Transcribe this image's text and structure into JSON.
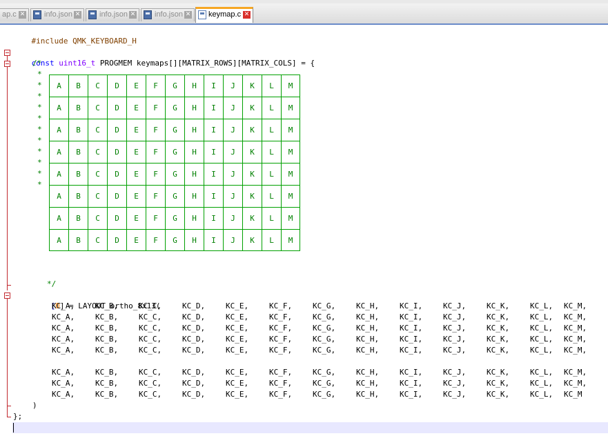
{
  "tabs": [
    {
      "label": "ap.c",
      "active": false
    },
    {
      "label": "info.json",
      "active": false
    },
    {
      "label": "info.json",
      "active": false
    },
    {
      "label": "info.json",
      "active": false
    },
    {
      "label": "keymap.c",
      "active": true
    }
  ],
  "code": {
    "include_directive": "#include",
    "include_target": "QMK_KEYBOARD_H",
    "const_kw": "const",
    "type_kw": "uint16_t",
    "decl_rest": "PROGMEM keymaps[][MATRIX_ROWS][MATRIX_COLS] = {",
    "comment_open": "/*",
    "comment_star": "*",
    "comment_close": "*/",
    "layer_open_bracket": "[",
    "layer_index": "0",
    "layer_rest": "] = LAYOUT_ortho_8x13(",
    "close_paren": ")",
    "close_brace": "};"
  },
  "grid": {
    "columns": [
      "A",
      "B",
      "C",
      "D",
      "E",
      "F",
      "G",
      "H",
      "I",
      "J",
      "K",
      "L",
      "M"
    ],
    "rows": 8
  },
  "keycodes": {
    "rows": [
      [
        "KC_A,",
        "KC_B,",
        "KC_C,",
        "KC_D,",
        "KC_E,",
        "KC_F,",
        "KC_G,",
        "KC_H,",
        "KC_I,",
        "KC_J,",
        "KC_K,",
        "KC_L,",
        "KC_M,"
      ],
      [
        "KC_A,",
        "KC_B,",
        "KC_C,",
        "KC_D,",
        "KC_E,",
        "KC_F,",
        "KC_G,",
        "KC_H,",
        "KC_I,",
        "KC_J,",
        "KC_K,",
        "KC_L,",
        "KC_M,"
      ],
      [
        "KC_A,",
        "KC_B,",
        "KC_C,",
        "KC_D,",
        "KC_E,",
        "KC_F,",
        "KC_G,",
        "KC_H,",
        "KC_I,",
        "KC_J,",
        "KC_K,",
        "KC_L,",
        "KC_M,"
      ],
      [
        "KC_A,",
        "KC_B,",
        "KC_C,",
        "KC_D,",
        "KC_E,",
        "KC_F,",
        "KC_G,",
        "KC_H,",
        "KC_I,",
        "KC_J,",
        "KC_K,",
        "KC_L,",
        "KC_M,"
      ],
      [
        "KC_A,",
        "KC_B,",
        "KC_C,",
        "KC_D,",
        "KC_E,",
        "KC_F,",
        "KC_G,",
        "KC_H,",
        "KC_I,",
        "KC_J,",
        "KC_K,",
        "KC_L,",
        "KC_M,"
      ],
      [
        "KC_A,",
        "KC_B,",
        "KC_C,",
        "KC_D,",
        "KC_E,",
        "KC_F,",
        "KC_G,",
        "KC_H,",
        "KC_I,",
        "KC_J,",
        "KC_K,",
        "KC_L,",
        "KC_M,"
      ],
      [
        "KC_A,",
        "KC_B,",
        "KC_C,",
        "KC_D,",
        "KC_E,",
        "KC_F,",
        "KC_G,",
        "KC_H,",
        "KC_I,",
        "KC_J,",
        "KC_K,",
        "KC_L,",
        "KC_M,"
      ],
      [
        "KC_A,",
        "KC_B,",
        "KC_C,",
        "KC_D,",
        "KC_E,",
        "KC_F,",
        "KC_G,",
        "KC_H,",
        "KC_I,",
        "KC_J,",
        "KC_K,",
        "KC_L,",
        "KC_M"
      ]
    ]
  },
  "colors": {
    "active_tab_accent": "#f6a623",
    "fold_marker": "#c1272d",
    "comment": "#008000",
    "keyword": "#0000ff",
    "type": "#8000ff",
    "preprocessor": "#804000",
    "number": "#ff8000",
    "caret_line": "#e8e8ff"
  }
}
